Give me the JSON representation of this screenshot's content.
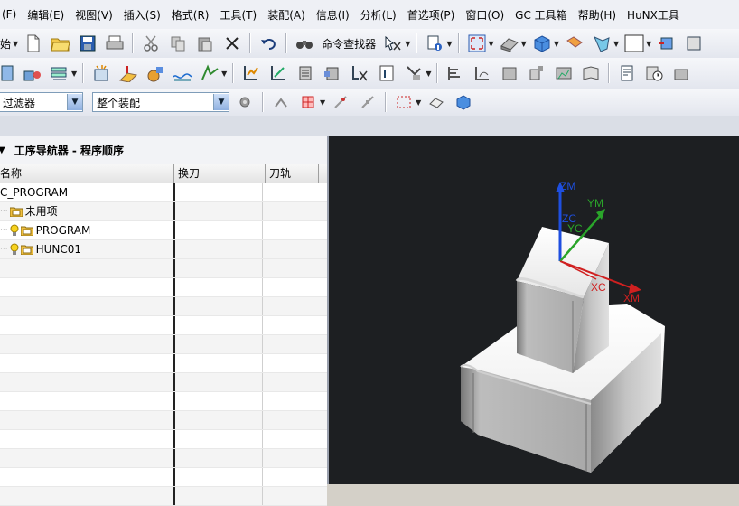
{
  "menu": [
    "(F)",
    "编辑(E)",
    "视图(V)",
    "插入(S)",
    "格式(R)",
    "工具(T)",
    "装配(A)",
    "信息(I)",
    "分析(L)",
    "首选项(P)",
    "窗口(O)",
    "GC 工具箱",
    "帮助(H)",
    "HuNX工具"
  ],
  "toolbar1": {
    "start_label": "始",
    "finder_label": "命令查找器"
  },
  "filter": {
    "type_value": "过滤器",
    "scope_value": "整个装配"
  },
  "navigator": {
    "title": "工序导航器 - 程序顺序",
    "columns": [
      "名称",
      "换刀",
      "刀轨"
    ],
    "rows": [
      {
        "name": "NC_PROGRAM",
        "display": "C_PROGRAM",
        "level": 0,
        "icon": "none"
      },
      {
        "name": "未用项",
        "level": 1,
        "icon": "folder"
      },
      {
        "name": "PROGRAM",
        "level": 1,
        "icon": "bulb-folder"
      },
      {
        "name": "HUNC01",
        "level": 1,
        "icon": "bulb-folder"
      }
    ],
    "empty_rows": 13
  },
  "viewport": {
    "background": "#1d1f22",
    "axes": {
      "zm": "ZM",
      "ym": "YM",
      "xm": "XM",
      "zc": "ZC",
      "yc": "YC",
      "xc": "XC"
    }
  }
}
